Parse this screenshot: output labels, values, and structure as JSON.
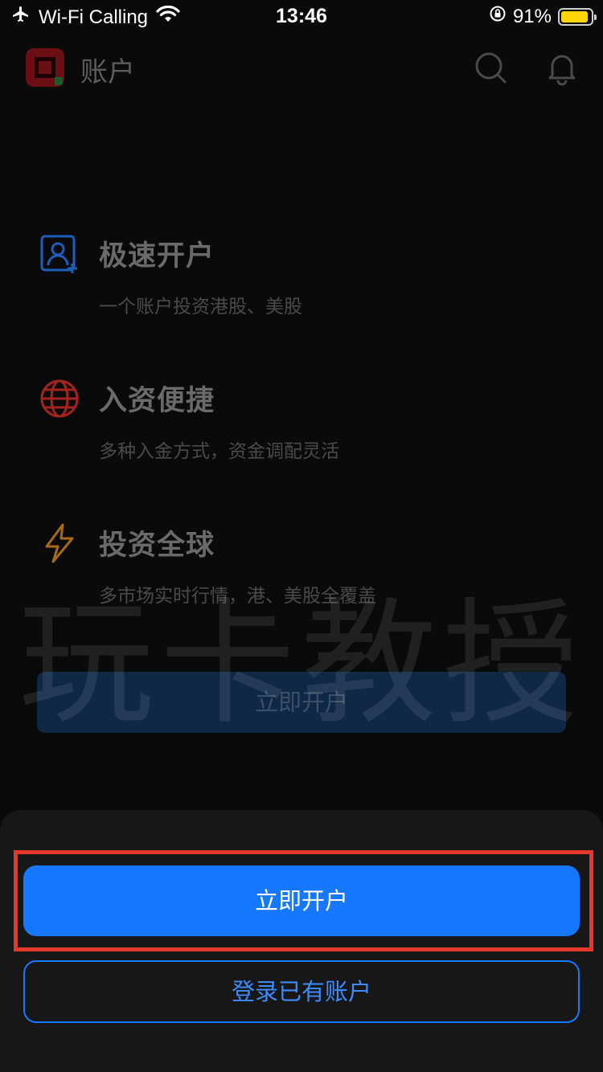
{
  "status_bar": {
    "carrier": "Wi-Fi Calling",
    "time": "13:46",
    "battery_percent": "91%",
    "battery_level": 0.91,
    "icons": [
      "airplane-icon",
      "wifi-icon",
      "rotation-lock-icon",
      "battery-icon"
    ]
  },
  "header": {
    "title": "账户",
    "icons": [
      "app-logo",
      "search-icon",
      "bell-icon"
    ]
  },
  "features": [
    {
      "title": "极速开户",
      "desc": "一个账户投资港股、美股",
      "icon": "user-plus-icon",
      "color": "#1e5db8"
    },
    {
      "title": "入资便捷",
      "desc": "多种入金方式，资金调配灵活",
      "icon": "globe-icon",
      "color": "#a32320"
    },
    {
      "title": "投资全球",
      "desc": "多市场实时行情，港、美股全覆盖",
      "icon": "lightning-icon",
      "color": "#a86a14"
    }
  ],
  "background_open_button": "立即开户",
  "watermark": "玩卡教授",
  "bottom_sheet": {
    "primary_button": "立即开户",
    "secondary_button": "登录已有账户"
  },
  "colors": {
    "accent": "#1677ff",
    "highlight": "#e5382b",
    "background": "#0a0a0a"
  }
}
